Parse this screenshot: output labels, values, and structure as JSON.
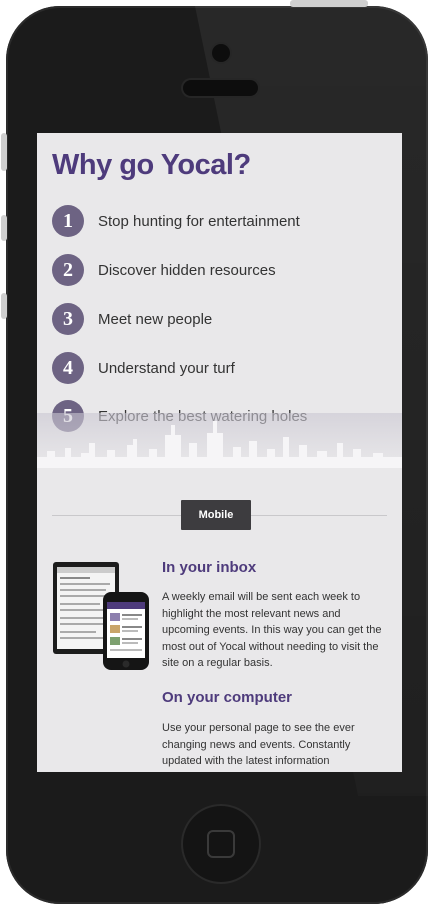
{
  "heading": "Why go Yocal?",
  "reasons": [
    {
      "number": "1",
      "text": "Stop hunting for entertainment"
    },
    {
      "number": "2",
      "text": "Discover hidden resources"
    },
    {
      "number": "3",
      "text": "Meet new people"
    },
    {
      "number": "4",
      "text": "Understand your turf"
    },
    {
      "number": "5",
      "text": "Explore the best watering holes"
    }
  ],
  "mobile_button_label": "Mobile",
  "sections": [
    {
      "title": "In your inbox",
      "body": "A weekly email will be sent each week to highlight the most relevant news and upcoming events. In this way you can get the most out of Yocal without needing to visit the site on a regular basis."
    },
    {
      "title": "On your computer",
      "body": "Use your personal page to see the ever changing news and events. Constantly updated with the latest information"
    }
  ],
  "colors": {
    "brand_purple": "#4e3b7c",
    "number_circle": "#6d6383",
    "button_dark": "#3d3c3f",
    "screen_bg": "#e9e8ea"
  }
}
